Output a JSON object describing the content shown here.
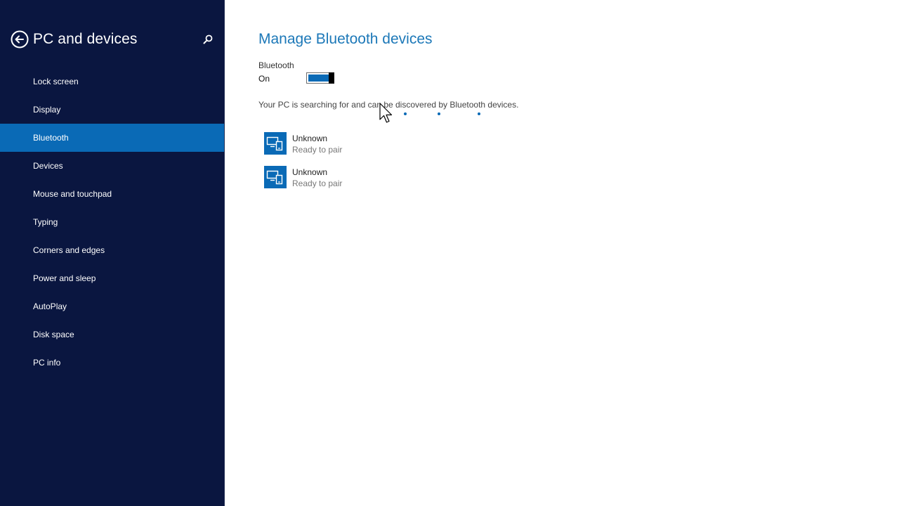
{
  "sidebar": {
    "title": "PC and devices",
    "back_icon": "back-arrow-icon",
    "search_icon": "search-icon",
    "items": [
      {
        "label": "Lock screen"
      },
      {
        "label": "Display"
      },
      {
        "label": "Bluetooth",
        "selected": true
      },
      {
        "label": "Devices"
      },
      {
        "label": "Mouse and touchpad"
      },
      {
        "label": "Typing"
      },
      {
        "label": "Corners and edges"
      },
      {
        "label": "Power and sleep"
      },
      {
        "label": "AutoPlay"
      },
      {
        "label": "Disk space"
      },
      {
        "label": "PC info"
      }
    ]
  },
  "main": {
    "title": "Manage Bluetooth devices",
    "toggle": {
      "label": "Bluetooth",
      "state_text": "On",
      "on": true
    },
    "status": "Your PC is searching for and can be discovered by Bluetooth devices.",
    "devices": [
      {
        "name": "Unknown",
        "status": "Ready to pair",
        "icon": "pc-and-phone-icon"
      },
      {
        "name": "Unknown",
        "status": "Ready to pair",
        "icon": "pc-and-phone-icon"
      }
    ]
  },
  "colors": {
    "sidebar_bg": "#0a1640",
    "accent": "#0a6ab6",
    "title_blue": "#1c78b8"
  }
}
